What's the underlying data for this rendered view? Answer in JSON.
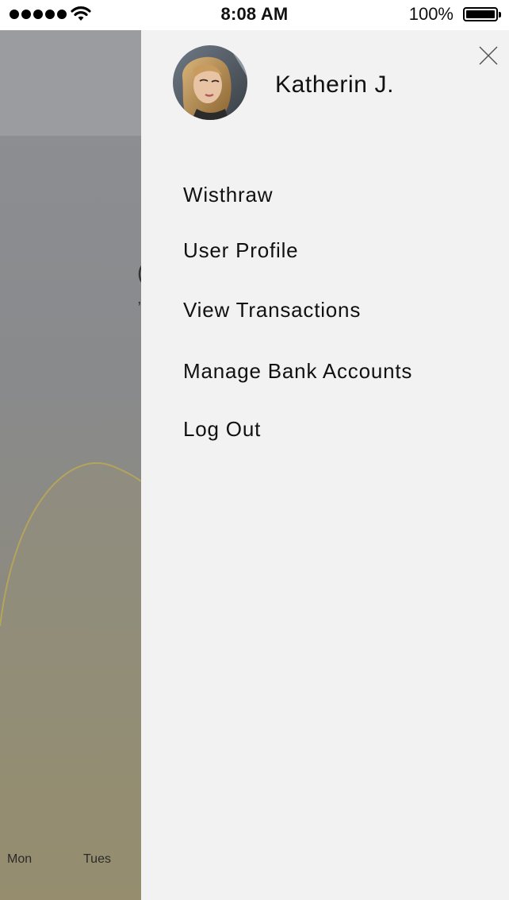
{
  "status_bar": {
    "time": "8:08 AM",
    "battery_percent": "100%",
    "signal_icon": "signal-dots-icon",
    "wifi_icon": "wifi-icon",
    "battery_icon": "battery-icon",
    "battery_level": 1.0
  },
  "background_screen": {
    "day_labels": [
      "Mon",
      "Tues"
    ],
    "accent_color": "#c9b04a"
  },
  "drawer": {
    "user_name": "Katherin J.",
    "avatar_icon": "user-avatar",
    "close_icon": "close-icon",
    "menu_items": [
      {
        "label": "Wisthraw"
      },
      {
        "label": "User Profile"
      },
      {
        "label": "View Transactions"
      },
      {
        "label": "Manage Bank Accounts"
      },
      {
        "label": "Log Out"
      }
    ]
  }
}
